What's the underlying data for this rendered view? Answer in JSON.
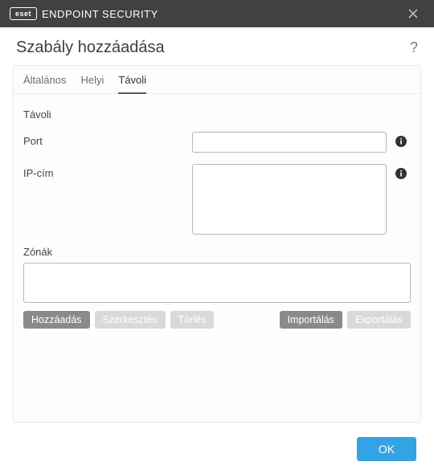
{
  "titlebar": {
    "brand_badge": "eset",
    "brand_text": "ENDPOINT SECURITY"
  },
  "header": {
    "title": "Szabály hozzáadása",
    "help": "?"
  },
  "tabs": [
    {
      "label": "Általános",
      "active": false
    },
    {
      "label": "Helyi",
      "active": false
    },
    {
      "label": "Távoli",
      "active": true
    }
  ],
  "form": {
    "section_label": "Távoli",
    "port_label": "Port",
    "port_value": "",
    "ip_label": "IP-cím",
    "ip_value": "",
    "zones_label": "Zónák",
    "zones_value": ""
  },
  "buttons": {
    "add": "Hozzáadás",
    "edit": "Szerkesztés",
    "delete": "Törlés",
    "import": "Importálás",
    "export": "Exportálás"
  },
  "footer": {
    "ok": "OK"
  }
}
